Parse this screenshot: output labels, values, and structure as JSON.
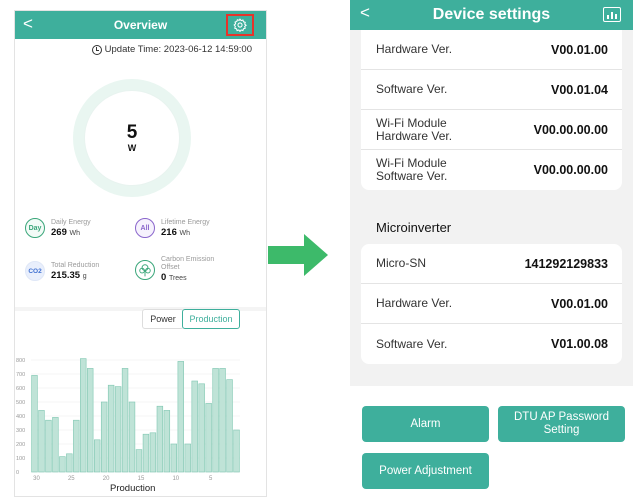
{
  "left": {
    "header": {
      "back": "<",
      "title": "Overview"
    },
    "update_time": "Update Time: 2023-06-12 14:59:00",
    "gauge": {
      "value": "5",
      "unit": "W"
    },
    "stats": {
      "daily": {
        "icon": "Day",
        "label": "Daily Energy",
        "value": "269",
        "unit": "Wh"
      },
      "lifetime": {
        "icon": "All",
        "label": "Lifetime Energy",
        "value": "216",
        "unit": "Wh"
      },
      "reduction": {
        "icon": "CO2",
        "label": "Total Reduction",
        "value": "215.35",
        "unit": "g"
      },
      "carbon": {
        "label1": "Carbon Emission",
        "label2": "Offset",
        "value": "0",
        "unit": "Trees"
      }
    },
    "tabs": {
      "power": "Power",
      "production": "Production"
    },
    "x_caption": "Production"
  },
  "chart_data": {
    "type": "bar",
    "y_ticks": [
      "800",
      "700",
      "600",
      "500",
      "400",
      "300",
      "200",
      "100",
      "0"
    ],
    "x_ticks": [
      "30",
      "25",
      "20",
      "15",
      "10",
      "5"
    ],
    "ylim": [
      0,
      850
    ],
    "values": [
      690,
      440,
      370,
      390,
      110,
      130,
      370,
      810,
      740,
      230,
      500,
      620,
      610,
      740,
      500,
      160,
      270,
      280,
      470,
      440,
      200,
      790,
      200,
      650,
      630,
      490,
      740,
      740,
      660,
      300
    ],
    "color": "#bfe3d7",
    "edge_color": "#7fc7b1"
  },
  "right": {
    "header": {
      "back": "<",
      "title": "Device settings"
    },
    "dtu_rows": [
      {
        "key": "Hardware Ver.",
        "value": "V00.01.00"
      },
      {
        "key": "Software Ver.",
        "value": "V00.01.04"
      },
      {
        "key": "Wi-Fi Module Hardware Ver.",
        "value": "V00.00.00.00"
      },
      {
        "key": "Wi-Fi Module Software Ver.",
        "value": "V00.00.00.00"
      }
    ],
    "microinverter_title": "Microinverter",
    "micro_rows": [
      {
        "key": "Micro-SN",
        "value": "141292129833"
      },
      {
        "key": "Hardware Ver.",
        "value": "V00.01.00"
      },
      {
        "key": "Software Ver.",
        "value": "V01.00.08"
      }
    ],
    "buttons": {
      "alarm": "Alarm",
      "dtu_ap": "DTU AP Password Setting",
      "power_adjustment": "Power Adjustment"
    }
  },
  "colors": {
    "accent": "#3eaf9c",
    "highlight_box": "#e8332a",
    "arrow": "#3dba6a"
  }
}
